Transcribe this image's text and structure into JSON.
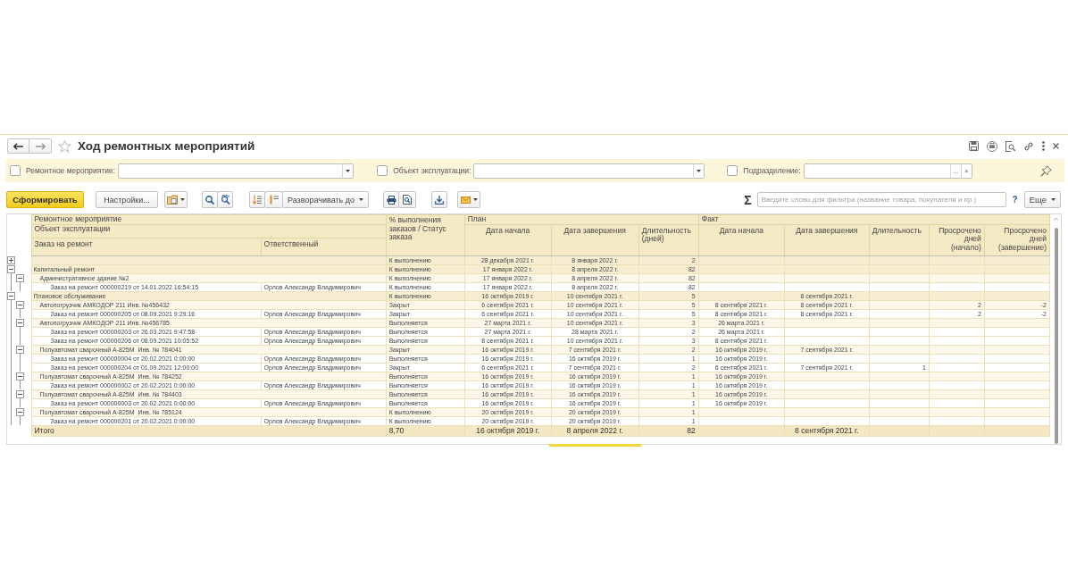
{
  "window": {
    "title": "Ход ремонтных мероприятий"
  },
  "filters": [
    {
      "label": "Ремонтное мероприятие:",
      "checked": false,
      "kind": "dropdown"
    },
    {
      "label": "Объект эксплуатации:",
      "checked": false,
      "kind": "dropdown"
    },
    {
      "label": "Подразделение:",
      "checked": false,
      "kind": "choice",
      "choose_button": "...",
      "clear_button": "×"
    }
  ],
  "toolbar": {
    "generate_button": "Сформировать",
    "settings_button": "Настройки...",
    "expand_button": "Разворачивать до",
    "sum_sign": "Σ",
    "search": {
      "placeholder": "Введите слово для фильтра (название товара, покупателя и пр.)"
    },
    "help_link": "?",
    "more_button": "Еще"
  },
  "table": {
    "header": {
      "group_levels": [
        "Ремонтное мероприятие",
        "Объект эксплуатации"
      ],
      "order_column": "Заказ на ремонт",
      "responsible_column": "Ответственный",
      "status_column": "% выполнения заказов / Статус заказа",
      "plan": {
        "title": "План",
        "columns": [
          "Дата начала",
          "Дата завершения",
          "Длительность (дней)"
        ]
      },
      "fact": {
        "title": "Факт",
        "columns": [
          "Дата начала",
          "Дата завершения",
          "Длительность",
          "Просрочено дней (начало)",
          "Просрочено дней (завершение)"
        ]
      }
    },
    "rows": [
      {
        "expanded": false,
        "status": "К выполнению",
        "plan_start": "28 декабря 2021 г.",
        "plan_end": "8 января 2022 г.",
        "plan_days": "2"
      },
      {
        "name": "Капитальный ремонт",
        "expanded": true,
        "status": "К выполнению",
        "plan_start": "17 января 2022 г.",
        "plan_end": "8 апреля 2022 г.",
        "plan_days": "82",
        "children": [
          {
            "name": "Административное здание №2",
            "expanded": true,
            "status": "К выполнению",
            "plan_start": "17 января 2022 г.",
            "plan_end": "8 апреля 2022 г.",
            "plan_days": "82",
            "children": [
              {
                "name": "Заказ на ремонт 000000219 от 14.01.2022 16:54:15",
                "responsible": "Орлов Александр Владимирович",
                "status": "К выполнению",
                "plan_start": "17 января 2022 г.",
                "plan_end": "8 апреля 2022 г.",
                "plan_days": "82"
              }
            ]
          }
        ]
      },
      {
        "name": "Плановое обслуживание",
        "expanded": true,
        "status": "К выполнению",
        "plan_start": "16 октября 2019 г.",
        "plan_end": "10 сентября 2021 г.",
        "plan_days": "5",
        "fact_end": "8 сентября 2021 г.",
        "children": [
          {
            "name": "Автопогрузчик АМКОДОР 211 Инв. №456432",
            "expanded": true,
            "status": "Закрыт",
            "plan_start": "6 сентября 2021 г.",
            "plan_end": "10 сентября 2021 г.",
            "plan_days": "5",
            "fact_start": "8 сентября 2021 г.",
            "fact_end": "8 сентября 2021 г.",
            "overdue_start_days": "2",
            "overdue_end_days": "-2",
            "children": [
              {
                "name": "Заказ на ремонт 000000205 от 08.09.2021 9:29:16",
                "responsible": "Орлов Александр Владимирович",
                "status": "Закрыт",
                "plan_start": "6 сентября 2021 г.",
                "plan_end": "10 сентября 2021 г.",
                "plan_days": "5",
                "fact_start": "8 сентября 2021 г.",
                "fact_end": "8 сентября 2021 г.",
                "overdue_start_days": "2",
                "overdue_end_days": "-2"
              }
            ]
          },
          {
            "name": "Автопогрузчик АМКОДОР 211 Инв. №456785",
            "expanded": true,
            "status": "Выполняется",
            "plan_start": "27 марта 2021 г.",
            "plan_end": "10 сентября 2021 г.",
            "plan_days": "3",
            "fact_start": "26 марта 2021 г.",
            "children": [
              {
                "name": "Заказ на ремонт 000000203 от 26.03.2021 9:47:58",
                "responsible": "Орлов Александр Владимирович",
                "status": "Выполняется",
                "plan_start": "27 марта 2021 г.",
                "plan_end": "28 марта 2021 г.",
                "plan_days": "2",
                "fact_start": "26 марта 2021 г."
              },
              {
                "name": "Заказ на ремонт 000000206 от 08.09.2021 10:05:52",
                "responsible": "Орлов Александр Владимирович",
                "status": "Выполняется",
                "plan_start": "8 сентября 2021 г.",
                "plan_end": "10 сентября 2021 г.",
                "plan_days": "3",
                "fact_start": "8 сентября 2021 г."
              }
            ]
          },
          {
            "name": "Полуавтомат сварочный А-825М  Инв. № 784041",
            "expanded": true,
            "status": "Закрыт",
            "plan_start": "16 октября 2019 г.",
            "plan_end": "7 сентября 2021 г.",
            "plan_days": "2",
            "fact_start": "16 октября 2019 г.",
            "fact_end": "7 сентября 2021 г.",
            "children": [
              {
                "name": "Заказ на ремонт 000000004 от 20.02.2021 0:00:00",
                "responsible": "Орлов Александр Владимирович",
                "status": "Выполняется",
                "plan_start": "16 октября 2019 г.",
                "plan_end": "16 октября 2019 г.",
                "plan_days": "1",
                "fact_start": "16 октября 2019 г."
              },
              {
                "name": "Заказ на ремонт 000000204 от 01.09.2021 12:00:00",
                "responsible": "Орлов Александр Владимирович",
                "status": "Закрыт",
                "plan_start": "6 сентября 2021 г.",
                "plan_end": "7 сентября 2021 г.",
                "plan_days": "2",
                "fact_start": "6 сентября 2021 г.",
                "fact_end": "7 сентября 2021 г.",
                "fact_days": "1"
              }
            ]
          },
          {
            "name": "Полуавтомат сварочный А-825М  Инв. № 784252",
            "expanded": true,
            "status": "Выполняется",
            "plan_start": "16 октября 2019 г.",
            "plan_end": "16 октября 2019 г.",
            "plan_days": "1",
            "fact_start": "16 октября 2019 г.",
            "children": [
              {
                "name": "Заказ на ремонт 000000002 от 20.02.2021 0:00:00",
                "responsible": "Орлов Александр Владимирович",
                "status": "Выполняется",
                "plan_start": "16 октября 2019 г.",
                "plan_end": "16 октября 2019 г.",
                "plan_days": "1",
                "fact_start": "16 октября 2019 г."
              }
            ]
          },
          {
            "name": "Полуавтомат сварочный А-825М  Инв. № 784403",
            "expanded": true,
            "status": "Выполняется",
            "plan_start": "16 октября 2019 г.",
            "plan_end": "16 октября 2019 г.",
            "plan_days": "1",
            "fact_start": "16 октября 2019 г.",
            "children": [
              {
                "name": "Заказ на ремонт 000000003 от 20.02.2021 0:00:00",
                "responsible": "Орлов Александр Владимирович",
                "status": "Выполняется",
                "plan_start": "16 октября 2019 г.",
                "plan_end": "16 октября 2019 г.",
                "plan_days": "1",
                "fact_start": "16 октября 2019 г."
              }
            ]
          },
          {
            "name": "Полуавтомат сварочный А-825М  Инв. № 785124",
            "expanded": true,
            "status": "К выполнению",
            "plan_start": "20 октября 2019 г.",
            "plan_end": "20 октября 2019 г.",
            "plan_days": "1",
            "children": [
              {
                "name": "Заказ на ремонт 000000201 от 20.02.2021 0:00:00",
                "responsible": "Орлов Александр Владимирович",
                "status": "К выполнению",
                "plan_start": "20 октября 2019 г.",
                "plan_end": "20 октября 2019 г.",
                "plan_days": "1"
              }
            ]
          }
        ]
      }
    ],
    "total": {
      "label": "Итого",
      "status": "8,70",
      "plan_start": "16 октября 2019 г.",
      "plan_end": "8 апреля 2022 г.",
      "plan_days": "82",
      "fact_end": "8 сентября 2021 г."
    }
  }
}
